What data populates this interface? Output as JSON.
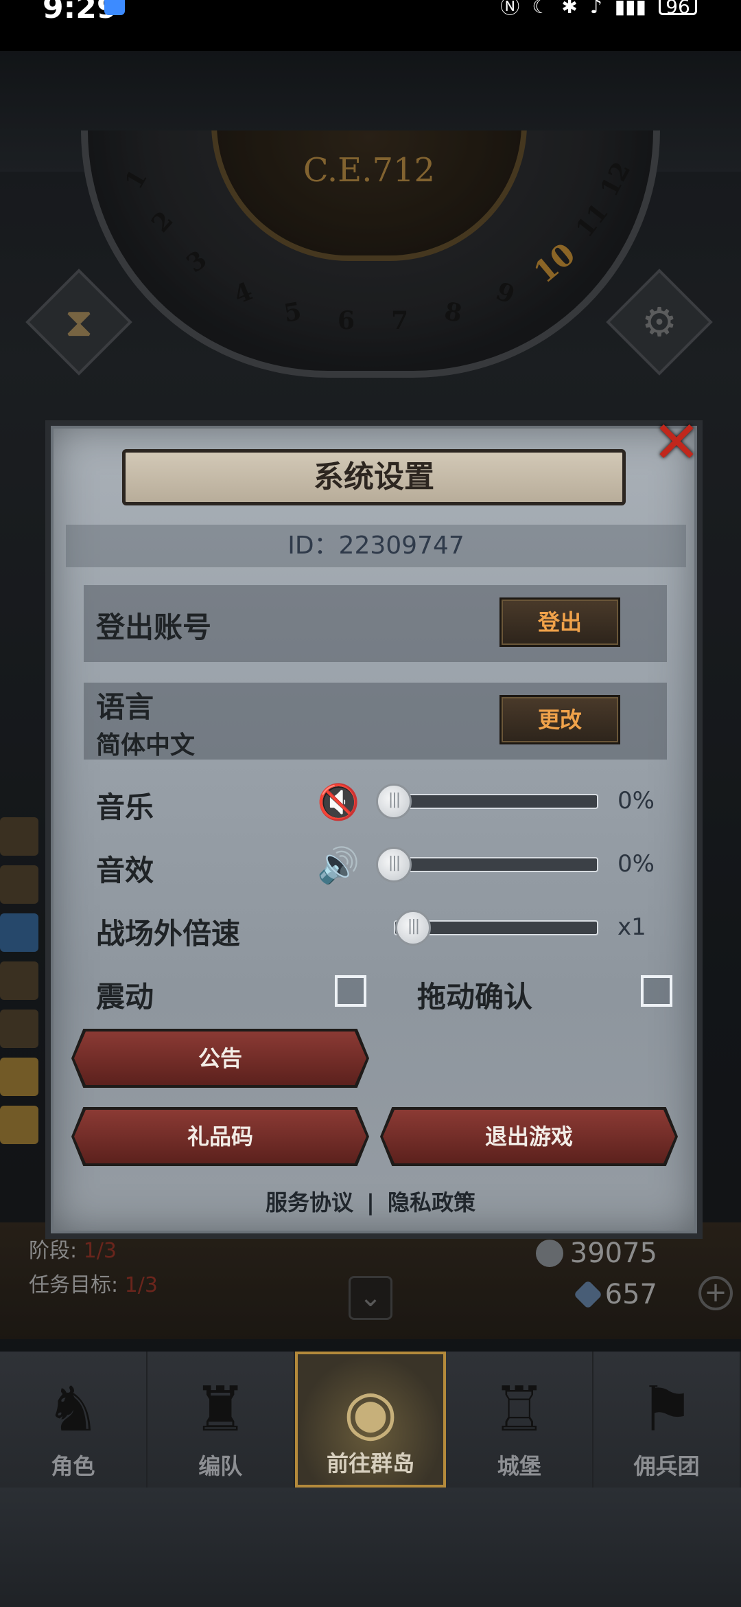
{
  "status_bar": {
    "time": "9:29",
    "battery": "96"
  },
  "game": {
    "era": "C.E.712",
    "wheel_numbers": [
      "1",
      "2",
      "3",
      "4",
      "5",
      "6",
      "7",
      "8",
      "9",
      "10",
      "11",
      "12"
    ],
    "active_month": "10"
  },
  "quest": {
    "stage_label": "阶段:",
    "stage_value": "1/3",
    "goal_label": "任务目标:",
    "goal_value": "1/3"
  },
  "currency": {
    "silver": "39075",
    "gems": "657"
  },
  "nav": {
    "items": [
      {
        "label": "角色",
        "icon": "knight-helmet-icon"
      },
      {
        "label": "编队",
        "icon": "armor-icon"
      },
      {
        "label": "前往群岛",
        "icon": "world-map-icon"
      },
      {
        "label": "城堡",
        "icon": "castle-icon"
      },
      {
        "label": "佣兵团",
        "icon": "mercenary-icon"
      }
    ],
    "active_index": 2
  },
  "dialog": {
    "title": "系统设置",
    "id_text": "ID：22309747",
    "logout_label": "登出账号",
    "logout_button": "登出",
    "language_label": "语言",
    "language_value": "简体中文",
    "language_button": "更改",
    "music_label": "音乐",
    "music_value": "0%",
    "music_level": 0,
    "sfx_label": "音效",
    "sfx_value": "0%",
    "sfx_level": 0,
    "speed_label": "战场外倍速",
    "speed_value": "x1",
    "speed_level": 0,
    "vibration_label": "震动",
    "vibration_checked": false,
    "drag_confirm_label": "拖动确认",
    "drag_confirm_checked": false,
    "announcement_button": "公告",
    "gift_code_button": "礼品码",
    "exit_button": "退出游戏",
    "terms_link": "服务协议",
    "separator": "|",
    "privacy_link": "隐私政策"
  },
  "colors": {
    "accent_gold": "#b48a3b",
    "button_red": "#8b3a34",
    "close_red": "#c1271c",
    "button_text_orange": "#f0a24a"
  }
}
